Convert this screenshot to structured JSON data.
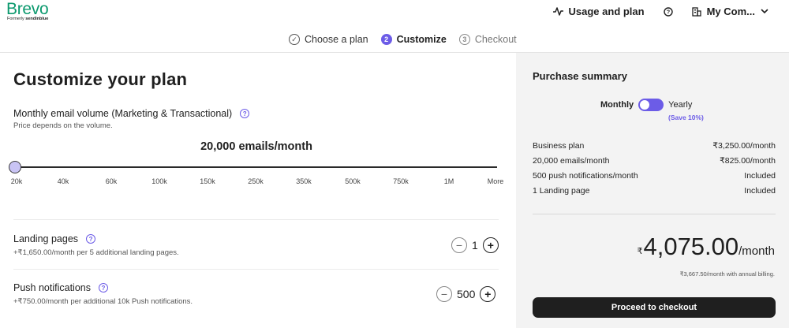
{
  "brand": {
    "name": "Brevo",
    "formerly_prefix": "Formerly",
    "formerly_name": "sendinblue"
  },
  "top_nav": {
    "usage_label": "Usage and plan",
    "account_label": "My Com..."
  },
  "stepper": [
    {
      "num": "✓",
      "label": "Choose a plan",
      "state": "done"
    },
    {
      "num": "2",
      "label": "Customize",
      "state": "active"
    },
    {
      "num": "3",
      "label": "Checkout",
      "state": "pending"
    }
  ],
  "main": {
    "title": "Customize your plan",
    "volume_label": "Monthly email volume (Marketing & Transactional)",
    "volume_sub": "Price depends on the volume.",
    "volume_value": "20,000 emails/month",
    "slider_ticks": [
      "20k",
      "40k",
      "60k",
      "100k",
      "150k",
      "250k",
      "350k",
      "500k",
      "750k",
      "1M",
      "More"
    ]
  },
  "addons": [
    {
      "title": "Landing pages",
      "sub": "+₹1,650.00/month per 5 additional landing pages.",
      "qty": "1"
    },
    {
      "title": "Push notifications",
      "sub": "+₹750.00/month per additional 10k Push notifications.",
      "qty": "500"
    }
  ],
  "summary": {
    "title": "Purchase summary",
    "monthly_label": "Monthly",
    "yearly_label": "Yearly",
    "save_note": "(Save 10%)",
    "lines": [
      {
        "label": "Business plan",
        "value": "₹3,250.00/month"
      },
      {
        "label": "20,000 emails/month",
        "value": "₹825.00/month"
      },
      {
        "label": "500 push notifications/month",
        "value": "Included"
      },
      {
        "label": "1 Landing page",
        "value": "Included"
      }
    ],
    "total_currency": "₹",
    "total_amount": "4,075.00",
    "total_period": "/month",
    "annual_note": "₹3,667.50/month with annual billing.",
    "checkout_label": "Proceed to checkout"
  },
  "colors": {
    "brand_green": "#0b996e",
    "accent": "#6c5ce7",
    "dark": "#1f1f1f"
  }
}
